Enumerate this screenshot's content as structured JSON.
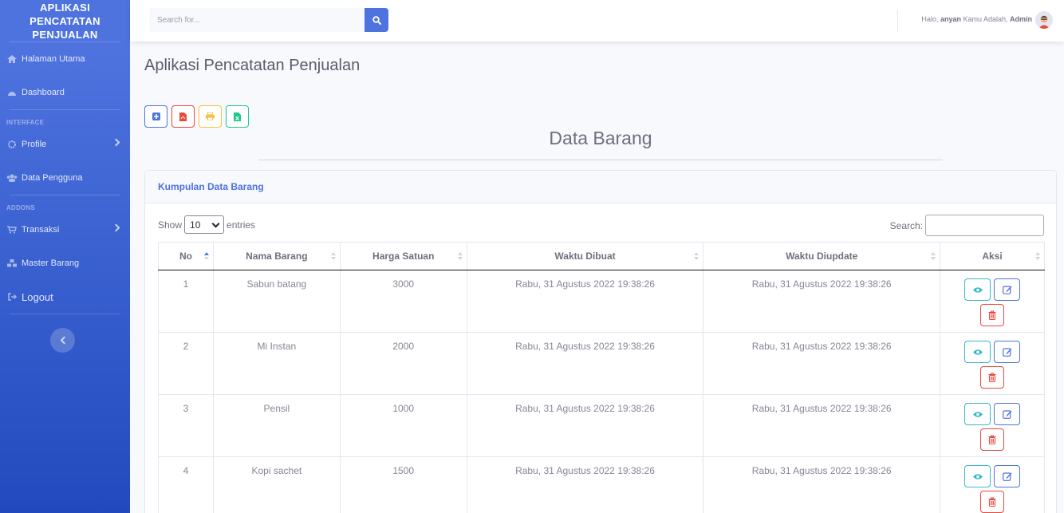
{
  "sidebar": {
    "brand": "APLIKASI\nPENCATATAN\nPENJUALAN",
    "items": [
      {
        "label": "Halaman Utama",
        "icon": "home-icon"
      },
      {
        "label": "Dashboard",
        "icon": "tachometer-icon"
      }
    ],
    "heading_interface": "INTERFACE",
    "interface_items": [
      {
        "label": "Profile",
        "icon": "gear-icon"
      },
      {
        "label": "Data Pengguna",
        "icon": "users-icon"
      }
    ],
    "heading_addons": "ADDONS",
    "addon_items": [
      {
        "label": "Transaksi",
        "icon": "cart-icon"
      },
      {
        "label": "Master Barang",
        "icon": "cubes-icon"
      }
    ],
    "logout": "Logout"
  },
  "topbar": {
    "search_placeholder": "Search for...",
    "greeting_prefix": "Halo, ",
    "user": "anyan",
    "greeting_middle": " Kamu Adalah, ",
    "role": "Admin"
  },
  "main": {
    "page_title": "Aplikasi Pencatatan Penjualan",
    "section_title": "Data Barang",
    "card_title": "Kumpulan Data Barang",
    "show_label": "Show",
    "entries_value": "10",
    "entries_label": "entries",
    "search_label": "Search:"
  },
  "table": {
    "headers": [
      "No",
      "Nama Barang",
      "Harga Satuan",
      "Waktu Dibuat",
      "Waktu Diupdate",
      "Aksi"
    ],
    "rows": [
      [
        "1",
        "Sabun batang",
        "3000",
        "Rabu, 31 Agustus 2022 19:38:26",
        "Rabu, 31 Agustus 2022 19:38:26"
      ],
      [
        "2",
        "Mi Instan",
        "2000",
        "Rabu, 31 Agustus 2022 19:38:26",
        "Rabu, 31 Agustus 2022 19:38:26"
      ],
      [
        "3",
        "Pensil",
        "1000",
        "Rabu, 31 Agustus 2022 19:38:26",
        "Rabu, 31 Agustus 2022 19:38:26"
      ],
      [
        "4",
        "Kopi sachet",
        "1500",
        "Rabu, 31 Agustus 2022 19:38:26",
        "Rabu, 31 Agustus 2022 19:38:26"
      ]
    ]
  },
  "colors": {
    "primary": "#4e73df",
    "danger": "#e74a3b",
    "warning": "#f6c23e",
    "success": "#1cc88a",
    "info": "#36b9cc"
  }
}
